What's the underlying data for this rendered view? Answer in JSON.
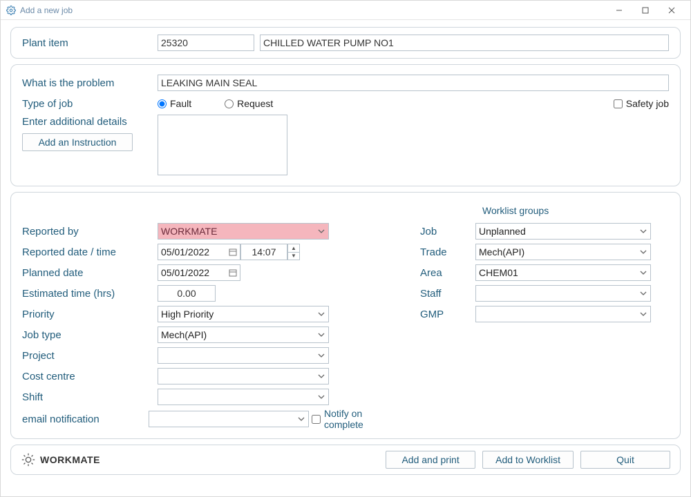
{
  "window": {
    "title": "Add a new job"
  },
  "plant": {
    "label": "Plant item",
    "id": "25320",
    "desc": "CHILLED WATER PUMP NO1"
  },
  "problem": {
    "label": "What is the problem",
    "value": "LEAKING MAIN SEAL",
    "type_label": "Type of job",
    "fault_label": "Fault",
    "request_label": "Request",
    "safety_label": "Safety job",
    "details_label": "Enter additional details",
    "instruction_btn": "Add an Instruction",
    "details_value": ""
  },
  "left": {
    "reported_by_label": "Reported by",
    "reported_by_value": "WORKMATE",
    "reported_dt_label": "Reported date / time",
    "reported_date": "05/01/2022",
    "reported_time": "14:07",
    "planned_date_label": "Planned date",
    "planned_date": "05/01/2022",
    "est_time_label": "Estimated time (hrs)",
    "est_time_value": "0.00",
    "priority_label": "Priority",
    "priority_value": "High Priority",
    "jobtype_label": "Job type",
    "jobtype_value": "Mech(API)",
    "project_label": "Project",
    "project_value": "",
    "costcentre_label": "Cost centre",
    "costcentre_value": "",
    "shift_label": "Shift",
    "shift_value": "",
    "email_label": "email notification",
    "email_value": "",
    "notify_label": "Notify on complete"
  },
  "right": {
    "header": "Worklist groups",
    "job_label": "Job",
    "job_value": "Unplanned",
    "trade_label": "Trade",
    "trade_value": "Mech(API)",
    "area_label": "Area",
    "area_value": "CHEM01",
    "staff_label": "Staff",
    "staff_value": "",
    "gmp_label": "GMP",
    "gmp_value": ""
  },
  "footer": {
    "brand": "WORKMATE",
    "add_print": "Add and print",
    "add_worklist": "Add to Worklist",
    "quit": "Quit"
  }
}
